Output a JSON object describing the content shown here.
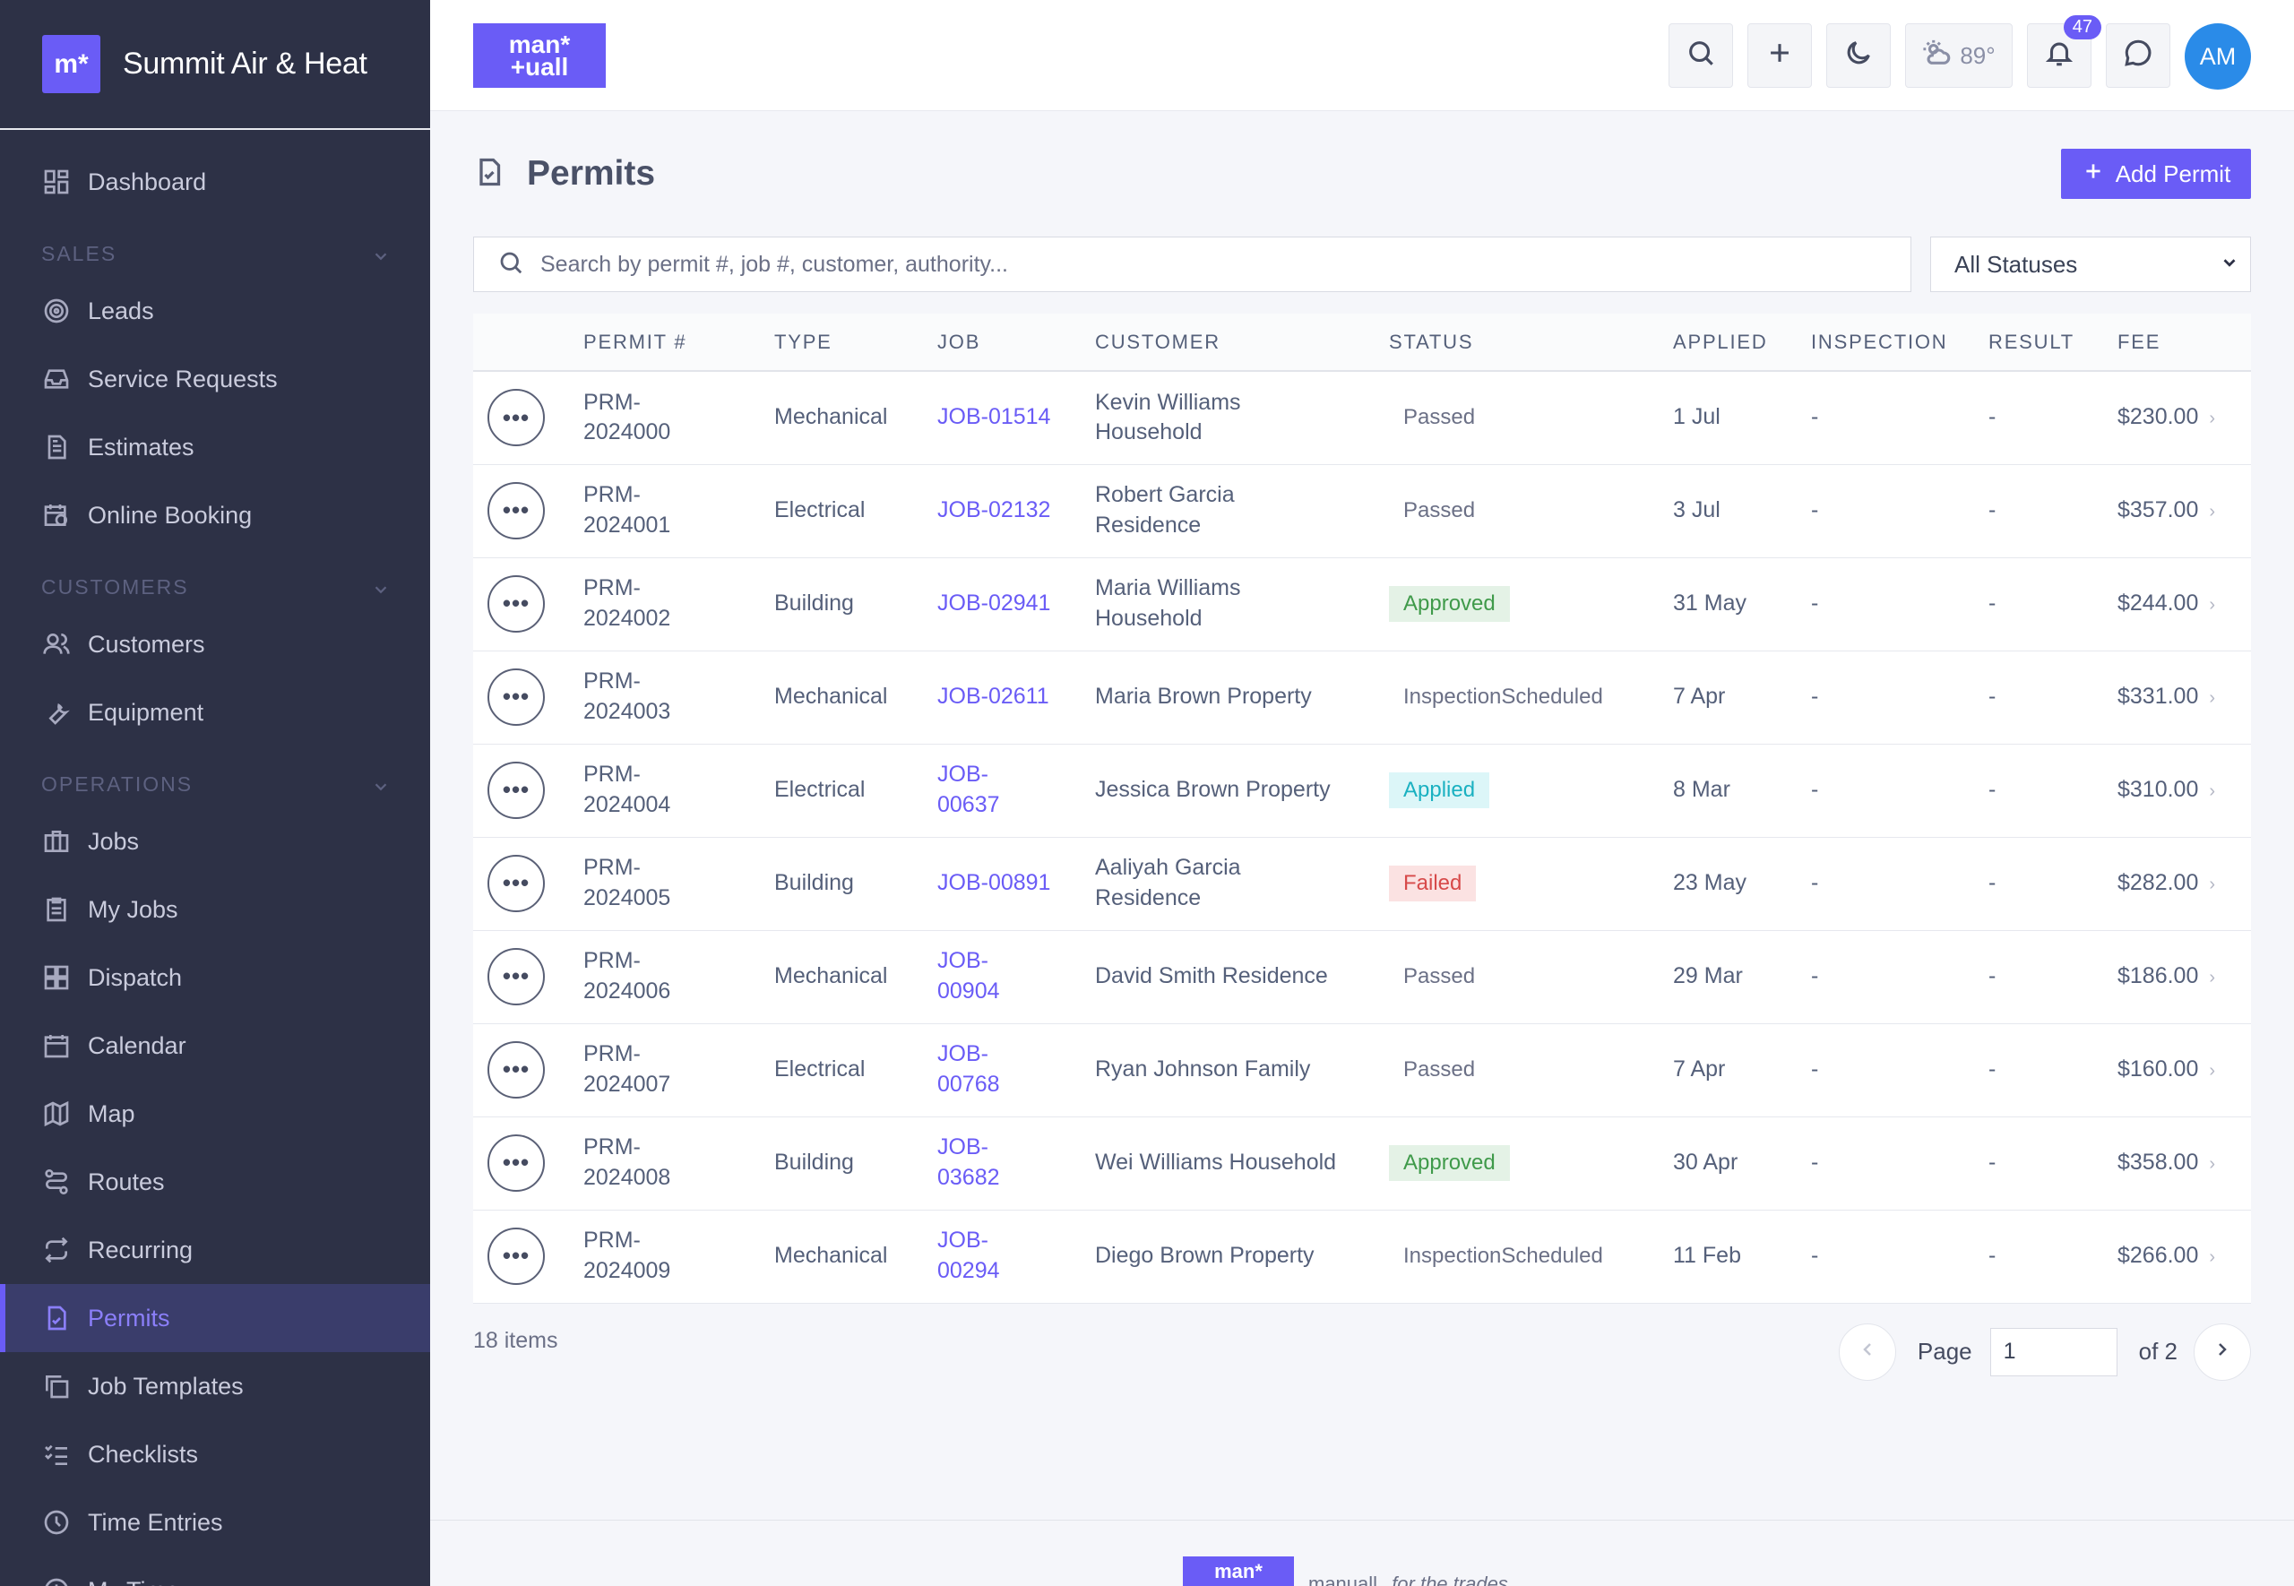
{
  "brand": {
    "logo": "m*",
    "name": "Summit Air & Heat"
  },
  "nav": {
    "dashboard": "Dashboard",
    "sales_section": "SALES",
    "leads": "Leads",
    "service_requests": "Service Requests",
    "estimates": "Estimates",
    "online_booking": "Online Booking",
    "customers_section": "CUSTOMERS",
    "customers": "Customers",
    "equipment": "Equipment",
    "operations_section": "OPERATIONS",
    "jobs": "Jobs",
    "my_jobs": "My Jobs",
    "dispatch": "Dispatch",
    "calendar": "Calendar",
    "map": "Map",
    "routes": "Routes",
    "recurring": "Recurring",
    "permits": "Permits",
    "job_templates": "Job Templates",
    "checklists": "Checklists",
    "time_entries": "Time Entries",
    "my_time": "My Time"
  },
  "topbar": {
    "logo_line1": "man*",
    "logo_line2": "+uall",
    "weather": "89°",
    "notifications": "47",
    "avatar": "AM"
  },
  "page": {
    "title": "Permits",
    "add_button": "Add Permit",
    "search_placeholder": "Search by permit #, job #, customer, authority...",
    "status_filter": "All Statuses"
  },
  "table": {
    "headers": [
      "PERMIT #",
      "TYPE",
      "JOB",
      "CUSTOMER",
      "STATUS",
      "APPLIED",
      "INSPECTION",
      "RESULT",
      "FEE"
    ],
    "rows": [
      {
        "permit_a": "PRM-",
        "permit_b": "2024000",
        "type": "Mechanical",
        "job_a": "JOB-01514",
        "job_b": "",
        "cust_a": "Kevin Williams",
        "cust_b": "Household",
        "status": "Passed",
        "status_key": "passed",
        "applied": "1 Jul",
        "inspection": "-",
        "result": "-",
        "fee": "$230.00"
      },
      {
        "permit_a": "PRM-",
        "permit_b": "2024001",
        "type": "Electrical",
        "job_a": "JOB-02132",
        "job_b": "",
        "cust_a": "Robert Garcia",
        "cust_b": "Residence",
        "status": "Passed",
        "status_key": "passed",
        "applied": "3 Jul",
        "inspection": "-",
        "result": "-",
        "fee": "$357.00"
      },
      {
        "permit_a": "PRM-",
        "permit_b": "2024002",
        "type": "Building",
        "job_a": "JOB-02941",
        "job_b": "",
        "cust_a": "Maria Williams",
        "cust_b": "Household",
        "status": "Approved",
        "status_key": "approved",
        "applied": "31 May",
        "inspection": "-",
        "result": "-",
        "fee": "$244.00"
      },
      {
        "permit_a": "PRM-",
        "permit_b": "2024003",
        "type": "Mechanical",
        "job_a": "JOB-02611",
        "job_b": "",
        "cust_a": "Maria Brown Property",
        "cust_b": "",
        "status": "InspectionScheduled",
        "status_key": "inspectionscheduled",
        "applied": "7 Apr",
        "inspection": "-",
        "result": "-",
        "fee": "$331.00"
      },
      {
        "permit_a": "PRM-",
        "permit_b": "2024004",
        "type": "Electrical",
        "job_a": "JOB-",
        "job_b": "00637",
        "cust_a": "Jessica Brown Property",
        "cust_b": "",
        "status": "Applied",
        "status_key": "applied",
        "applied": "8 Mar",
        "inspection": "-",
        "result": "-",
        "fee": "$310.00"
      },
      {
        "permit_a": "PRM-",
        "permit_b": "2024005",
        "type": "Building",
        "job_a": "JOB-00891",
        "job_b": "",
        "cust_a": "Aaliyah Garcia",
        "cust_b": "Residence",
        "status": "Failed",
        "status_key": "failed",
        "applied": "23 May",
        "inspection": "-",
        "result": "-",
        "fee": "$282.00"
      },
      {
        "permit_a": "PRM-",
        "permit_b": "2024006",
        "type": "Mechanical",
        "job_a": "JOB-",
        "job_b": "00904",
        "cust_a": "David Smith Residence",
        "cust_b": "",
        "status": "Passed",
        "status_key": "passed",
        "applied": "29 Mar",
        "inspection": "-",
        "result": "-",
        "fee": "$186.00"
      },
      {
        "permit_a": "PRM-",
        "permit_b": "2024007",
        "type": "Electrical",
        "job_a": "JOB-",
        "job_b": "00768",
        "cust_a": "Ryan Johnson Family",
        "cust_b": "",
        "status": "Passed",
        "status_key": "passed",
        "applied": "7 Apr",
        "inspection": "-",
        "result": "-",
        "fee": "$160.00"
      },
      {
        "permit_a": "PRM-",
        "permit_b": "2024008",
        "type": "Building",
        "job_a": "JOB-",
        "job_b": "03682",
        "cust_a": "Wei Williams Household",
        "cust_b": "",
        "status": "Approved",
        "status_key": "approved",
        "applied": "30 Apr",
        "inspection": "-",
        "result": "-",
        "fee": "$358.00"
      },
      {
        "permit_a": "PRM-",
        "permit_b": "2024009",
        "type": "Mechanical",
        "job_a": "JOB-",
        "job_b": "00294",
        "cust_a": "Diego Brown Property",
        "cust_b": "",
        "status": "InspectionScheduled",
        "status_key": "inspectionscheduled",
        "applied": "11 Feb",
        "inspection": "-",
        "result": "-",
        "fee": "$266.00"
      }
    ]
  },
  "pagination": {
    "count": "18 items",
    "page_label": "Page",
    "page_value": "1",
    "of_label": "of 2"
  },
  "footer": {
    "logo": "man*",
    "brand": "manuall",
    "tagline": "for the trades"
  },
  "colors": {
    "accent": "#6a5cf6",
    "sidebar": "#2d3146",
    "avatar": "#2a8be8"
  }
}
